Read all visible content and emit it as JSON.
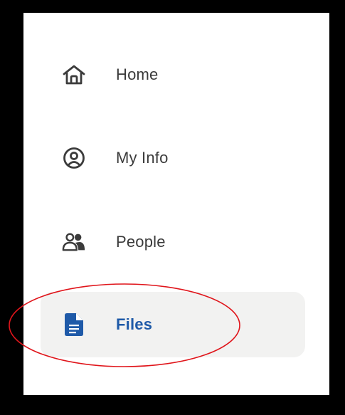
{
  "nav": {
    "items": [
      {
        "label": "Home",
        "icon": "home-icon",
        "active": false
      },
      {
        "label": "My Info",
        "icon": "user-circle-icon",
        "active": false
      },
      {
        "label": "People",
        "icon": "people-icon",
        "active": false
      },
      {
        "label": "Files",
        "icon": "file-icon",
        "active": true
      }
    ]
  },
  "colors": {
    "active_text": "#1f5aa8",
    "active_bg": "#f2f2f1",
    "text": "#3b3b3b",
    "icon": "#3b3b3b",
    "highlight_ring": "#e0151b",
    "frame": "#000000"
  }
}
